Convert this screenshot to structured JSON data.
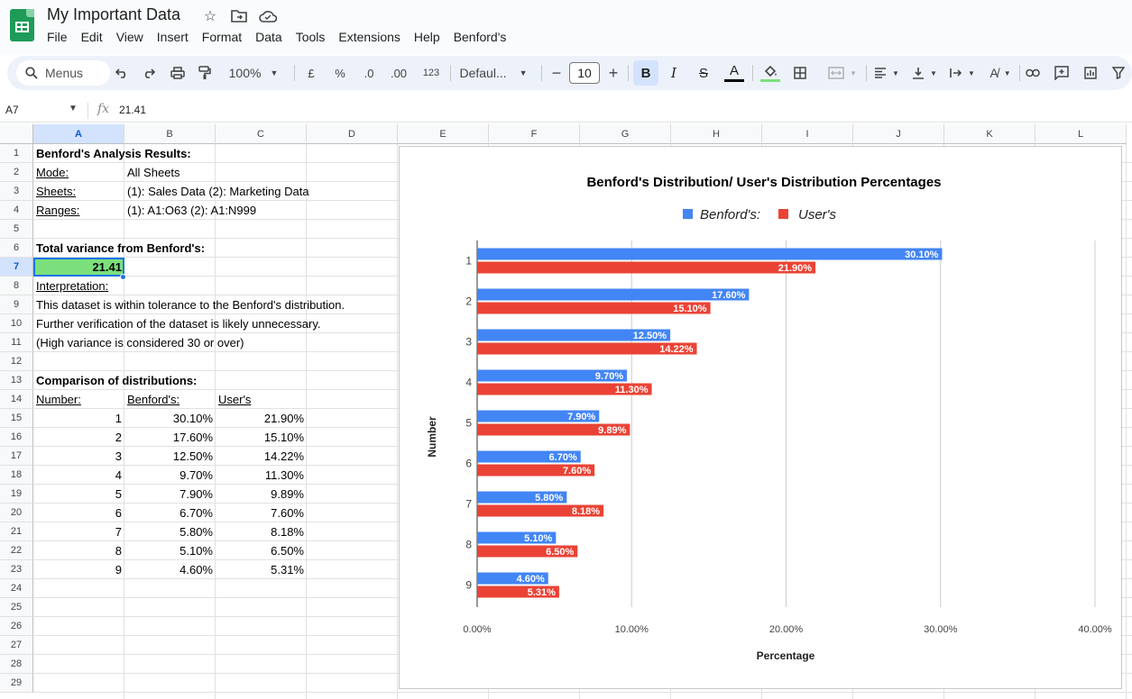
{
  "app": {
    "doc_title": "My Important Data",
    "menus": [
      "File",
      "Edit",
      "View",
      "Insert",
      "Format",
      "Data",
      "Tools",
      "Extensions",
      "Help",
      "Benford's"
    ]
  },
  "toolbar": {
    "menus_label": "Menus",
    "zoom": "100%",
    "currency": "£",
    "percent": "%",
    "dec_decrease": ".0",
    "dec_increase": ".00",
    "number_format": "123",
    "font": "Defaul...",
    "font_size": "10",
    "bold": "B",
    "italic": "I",
    "strike": "S",
    "text_color": "A"
  },
  "formula_bar": {
    "cell_ref": "A7",
    "fx": "fx",
    "value": "21.41"
  },
  "columns": [
    "A",
    "B",
    "C",
    "D",
    "E",
    "F",
    "G",
    "H",
    "I",
    "J",
    "K",
    "L"
  ],
  "rows": [
    "1",
    "2",
    "3",
    "4",
    "5",
    "6",
    "7",
    "8",
    "9",
    "10",
    "11",
    "12",
    "13",
    "14",
    "15",
    "16",
    "17",
    "18",
    "19",
    "20",
    "21",
    "22",
    "23",
    "24",
    "25",
    "26",
    "27",
    "28",
    "29"
  ],
  "sheet": {
    "title": "Benford's Analysis Results:",
    "mode_label": "Mode:",
    "mode_value": "All Sheets",
    "sheets_label": "Sheets:",
    "sheets_value": "(1): Sales Data (2): Marketing Data",
    "ranges_label": "Ranges:",
    "ranges_value": "(1): A1:O63 (2): A1:N999",
    "variance_label": "Total variance from Benford's:",
    "variance_value": "21.41",
    "interp_label": "Interpretation:",
    "interp_1": "This dataset is within tolerance to the Benford's distribution.",
    "interp_2": "Further verification of the dataset is likely unnecessary.",
    "interp_3": "(High variance is considered 30 or over)",
    "comparison_label": "Comparison of distributions:",
    "hdr_number": "Number:",
    "hdr_benford": "Benford's:",
    "hdr_user": "User's",
    "table": [
      {
        "n": "1",
        "b": "30.10%",
        "u": "21.90%"
      },
      {
        "n": "2",
        "b": "17.60%",
        "u": "15.10%"
      },
      {
        "n": "3",
        "b": "12.50%",
        "u": "14.22%"
      },
      {
        "n": "4",
        "b": "9.70%",
        "u": "11.30%"
      },
      {
        "n": "5",
        "b": "7.90%",
        "u": "9.89%"
      },
      {
        "n": "6",
        "b": "6.70%",
        "u": "7.60%"
      },
      {
        "n": "7",
        "b": "5.80%",
        "u": "8.18%"
      },
      {
        "n": "8",
        "b": "5.10%",
        "u": "6.50%"
      },
      {
        "n": "9",
        "b": "4.60%",
        "u": "5.31%"
      }
    ]
  },
  "chart_data": {
    "type": "bar",
    "orientation": "horizontal",
    "title": "Benford's Distribution/ User's Distribution Percentages",
    "xlabel": "Percentage",
    "ylabel": "Number",
    "categories": [
      "1",
      "2",
      "3",
      "4",
      "5",
      "6",
      "7",
      "8",
      "9"
    ],
    "xlim": [
      0,
      40
    ],
    "x_ticks": [
      "0.00%",
      "10.00%",
      "20.00%",
      "30.00%",
      "40.00%"
    ],
    "legend_position": "top",
    "grid": true,
    "series": [
      {
        "name": "Benford's:",
        "color": "#4285f4",
        "values": [
          30.1,
          17.6,
          12.5,
          9.7,
          7.9,
          6.7,
          5.8,
          5.1,
          4.6
        ],
        "labels": [
          "30.10%",
          "17.60%",
          "12.50%",
          "9.70%",
          "7.90%",
          "6.70%",
          "5.80%",
          "5.10%",
          "4.60%"
        ]
      },
      {
        "name": "User's",
        "color": "#ea4335",
        "values": [
          21.9,
          15.1,
          14.22,
          11.3,
          9.89,
          7.6,
          8.18,
          6.5,
          5.31
        ],
        "labels": [
          "21.90%",
          "15.10%",
          "14.22%",
          "11.30%",
          "9.89%",
          "7.60%",
          "8.18%",
          "6.50%",
          "5.31%"
        ]
      }
    ]
  }
}
